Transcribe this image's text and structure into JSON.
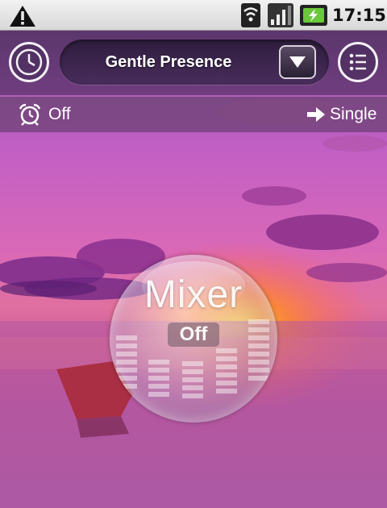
{
  "status_bar": {
    "time": "17:15",
    "icons": [
      "warning-icon",
      "wifi-icon",
      "signal-icon",
      "battery-charging-icon"
    ]
  },
  "header": {
    "preset_name": "Gentle Presence",
    "left_icon": "clock-icon",
    "right_icon": "list-icon",
    "dropdown_icon": "triangle-down-icon"
  },
  "subbar": {
    "alarm_label": "Off",
    "alarm_icon": "alarm-clock-icon",
    "mode_label": "Single",
    "mode_icon": "arrow-right-icon"
  },
  "mixer": {
    "title": "Mixer",
    "status": "Off"
  },
  "colors": {
    "sky_top": "#c45fc8",
    "sunset_orange": "#ff8a2a",
    "water": "#b85a9a",
    "cloud": "#7a2a8a"
  }
}
